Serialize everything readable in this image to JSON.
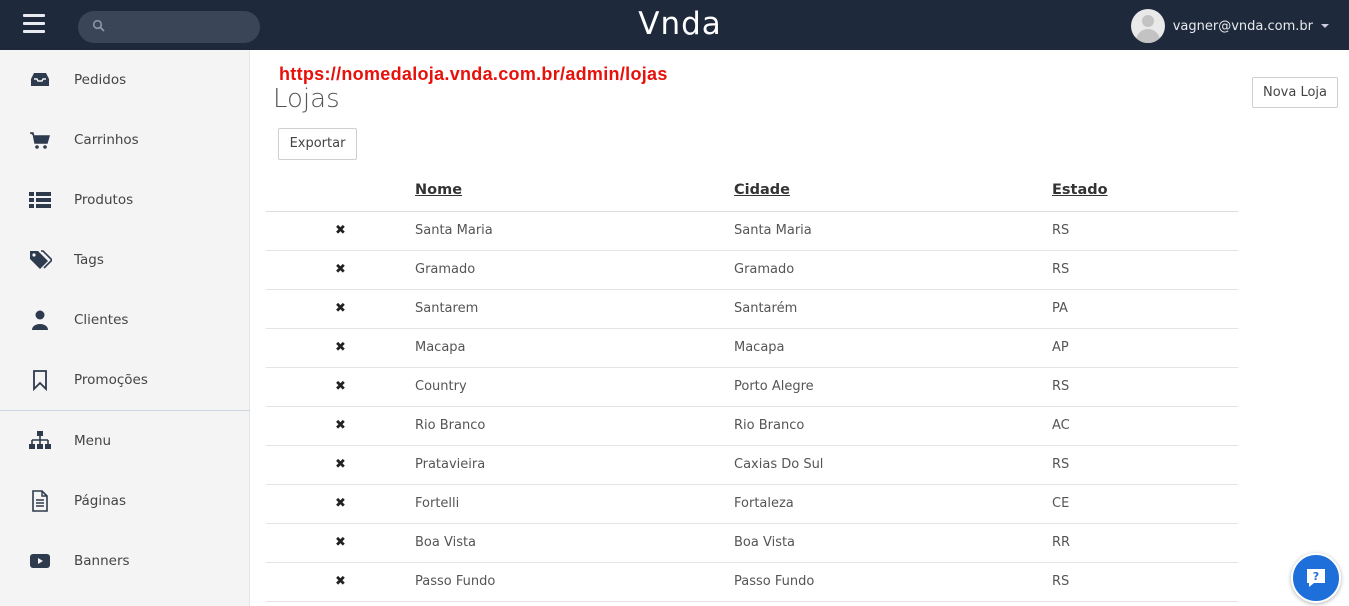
{
  "header": {
    "brand": "Vnda",
    "search_placeholder": "",
    "user_email": "vagner@vnda.com.br"
  },
  "sidebar": {
    "items": [
      {
        "label": "Pedidos",
        "icon": "inbox-icon"
      },
      {
        "label": "Carrinhos",
        "icon": "cart-icon"
      },
      {
        "label": "Produtos",
        "icon": "list-icon"
      },
      {
        "label": "Tags",
        "icon": "tags-icon"
      },
      {
        "label": "Clientes",
        "icon": "user-icon"
      },
      {
        "label": "Promoções",
        "icon": "bookmark-icon"
      },
      {
        "label": "Menu",
        "icon": "sitemap-icon"
      },
      {
        "label": "Páginas",
        "icon": "document-icon"
      },
      {
        "label": "Banners",
        "icon": "video-icon"
      }
    ]
  },
  "main": {
    "url_annotation": "https://nomedaloja.vnda.com.br/admin/lojas",
    "title": "Lojas",
    "export_label": "Exportar",
    "new_store_label": "Nova Loja",
    "columns": [
      "Nome",
      "Cidade",
      "Estado"
    ],
    "rows": [
      {
        "nome": "Santa Maria",
        "cidade": "Santa Maria",
        "estado": "RS"
      },
      {
        "nome": "Gramado",
        "cidade": "Gramado",
        "estado": "RS"
      },
      {
        "nome": "Santarem",
        "cidade": "Santarém",
        "estado": "PA"
      },
      {
        "nome": "Macapa",
        "cidade": "Macapa",
        "estado": "AP"
      },
      {
        "nome": "Country",
        "cidade": "Porto Alegre",
        "estado": "RS"
      },
      {
        "nome": "Rio Branco",
        "cidade": "Rio Branco",
        "estado": "AC"
      },
      {
        "nome": "Pratavieira",
        "cidade": "Caxias Do Sul",
        "estado": "RS"
      },
      {
        "nome": "Fortelli",
        "cidade": "Fortaleza",
        "estado": "CE"
      },
      {
        "nome": "Boa Vista",
        "cidade": "Boa Vista",
        "estado": "RR"
      },
      {
        "nome": "Passo Fundo",
        "cidade": "Passo Fundo",
        "estado": "RS"
      }
    ]
  },
  "colors": {
    "topbar": "#1e2a3b",
    "annotation": "#e8100a",
    "help_button": "#1e6fd9"
  }
}
